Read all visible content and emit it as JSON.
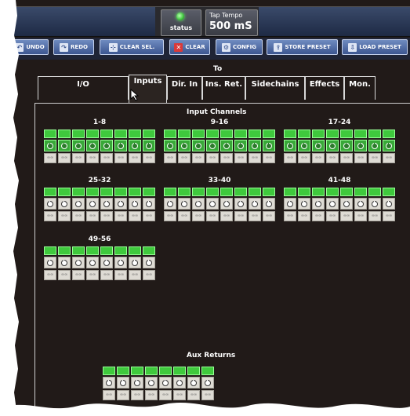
{
  "topbar": {
    "status_label": "status",
    "tap_tempo_label": "Tap Tempo",
    "tap_tempo_value": "500 mS"
  },
  "toolbar": {
    "undo": "UNDO",
    "redo": "REDO",
    "clear_sel": "CLEAR SEL.",
    "clear": "CLEAR",
    "config": "CONFIG",
    "store_preset": "STORE PRESET",
    "load_preset": "LOAD PRESET"
  },
  "routing": {
    "to_label": "To",
    "tabs": [
      "I/O",
      "Inputs",
      "Dir. In",
      "Ins. Ret.",
      "Sidechains",
      "Effects",
      "Mon."
    ],
    "active_tab": "Inputs"
  },
  "input_channels": {
    "title": "Input Channels",
    "groups": [
      {
        "label": "1-8",
        "selected": true
      },
      {
        "label": "9-16",
        "selected": true
      },
      {
        "label": "17-24",
        "selected": true
      },
      {
        "label": "25-32",
        "selected": false
      },
      {
        "label": "33-40",
        "selected": false
      },
      {
        "label": "41-48",
        "selected": false
      },
      {
        "label": "49-56",
        "selected": false
      }
    ]
  },
  "aux_returns": {
    "title": "Aux Returns",
    "count": 8
  },
  "colors": {
    "active_green": "#3fc93d",
    "toolbar_blue": "#3c5690",
    "background": "#211a18"
  }
}
